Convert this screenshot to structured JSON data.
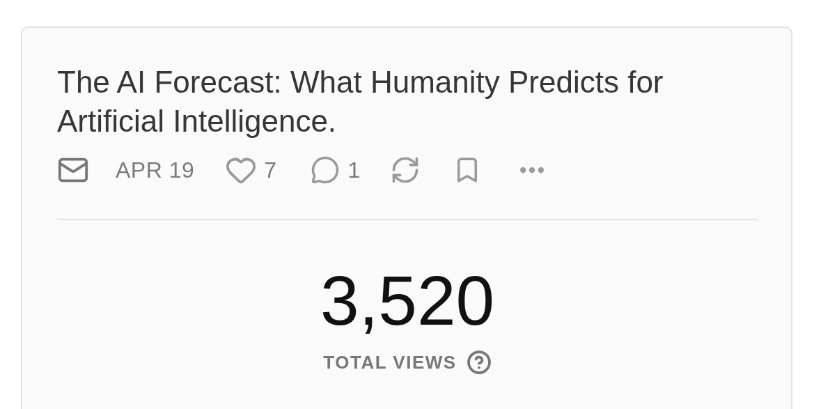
{
  "post": {
    "title": "The AI Forecast: What Humanity Predicts for Artificial Intelligence.",
    "date": "APR 19",
    "likes": "7",
    "comments": "1"
  },
  "stats": {
    "value": "3,520",
    "label": "TOTAL VIEWS"
  }
}
